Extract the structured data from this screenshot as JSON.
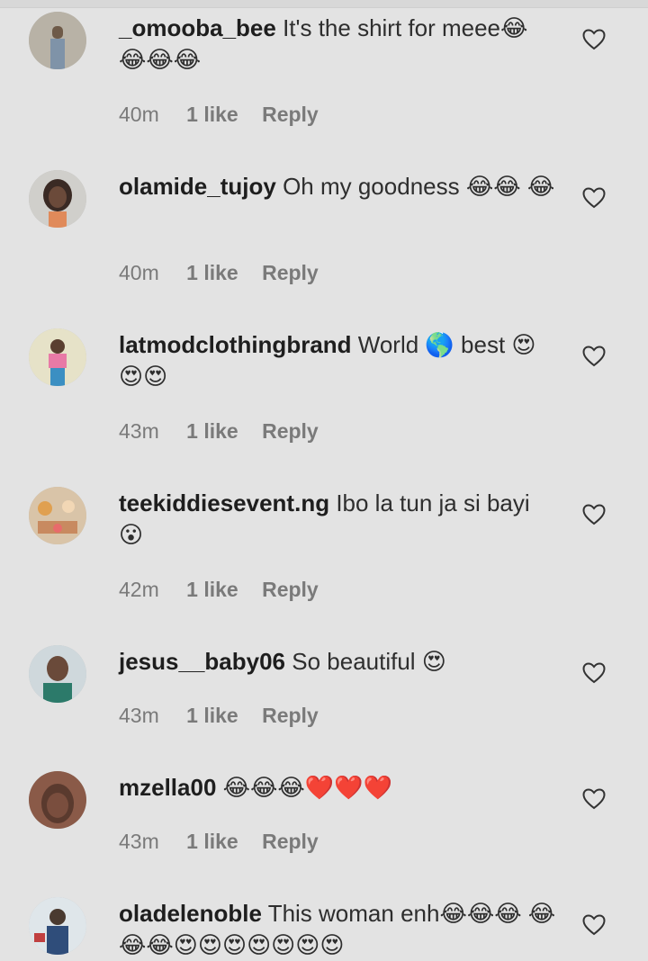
{
  "comments": [
    {
      "username": "_omooba_bee",
      "text": "It's the shirt for meee😂 😂😂😂",
      "time": "40m",
      "likes": "1 like",
      "reply": "Reply",
      "avatar": "avatar-omooba"
    },
    {
      "username": "olamide_tujoy",
      "text": "Oh my goodness 😂😂 😂",
      "time": "40m",
      "likes": "1 like",
      "reply": "Reply",
      "avatar": "avatar-olamide"
    },
    {
      "username": "latmodclothingbrand",
      "text": "World 🌎 best 😍😍😍",
      "time": "43m",
      "likes": "1 like",
      "reply": "Reply",
      "avatar": "avatar-latmod"
    },
    {
      "username": "teekiddiesevent.ng",
      "text": "Ibo la tun ja si bayi 😮",
      "time": "42m",
      "likes": "1 like",
      "reply": "Reply",
      "avatar": "avatar-teekiddies"
    },
    {
      "username": "jesus__baby06",
      "text": "So beautiful 😍",
      "time": "43m",
      "likes": "1 like",
      "reply": "Reply",
      "avatar": "avatar-jesus"
    },
    {
      "username": "mzella00",
      "text": "😂😂😂❤️❤️❤️",
      "time": "43m",
      "likes": "1 like",
      "reply": "Reply",
      "avatar": "avatar-mzella"
    },
    {
      "username": "oladelenoble",
      "text": "This woman enh😂😂😂 😂😂😂😍😍😍😍😍😍😍",
      "time": "",
      "likes": "",
      "reply": "",
      "avatar": "avatar-oladele"
    }
  ],
  "icons": {
    "like": "heart-outline-icon"
  },
  "colors": {
    "background": "#e3e3e3",
    "meta": "#7a7a7a",
    "username": "#1e1e1e"
  }
}
